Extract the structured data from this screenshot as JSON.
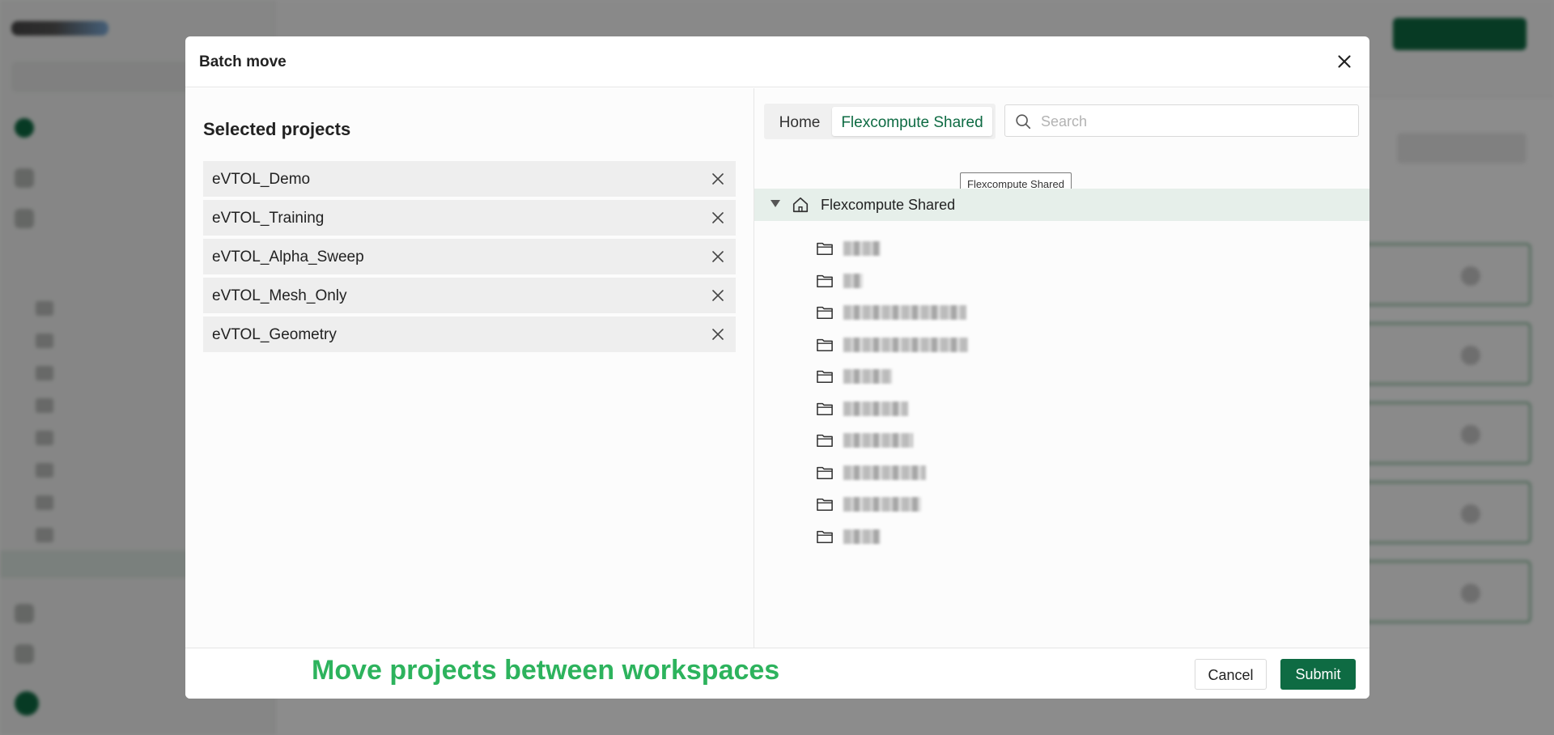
{
  "dialog": {
    "title": "Batch move",
    "selected_heading": "Selected projects",
    "selected_projects": [
      "eVTOL_Demo",
      "eVTOL_Training",
      "eVTOL_Alpha_Sweep",
      "eVTOL_Mesh_Only",
      "eVTOL_Geometry"
    ],
    "workspace_tabs": [
      "Home",
      "Flexcompute Shared"
    ],
    "active_tab": "Flexcompute Shared",
    "search_placeholder": "Search",
    "tooltip": "Flexcompute Shared",
    "tree": {
      "root_label": "Flexcompute Shared",
      "child_folder_count_visible": 10
    },
    "cancel_label": "Cancel",
    "submit_label": "Submit"
  },
  "caption": "Move projects between workspaces",
  "colors": {
    "accent": "#0e6b43",
    "caption": "#2db35d",
    "tree_root_highlight": "#e6efea"
  },
  "icons": [
    "close-icon",
    "search-icon",
    "caret-down-icon",
    "home-icon",
    "folder-icon"
  ]
}
